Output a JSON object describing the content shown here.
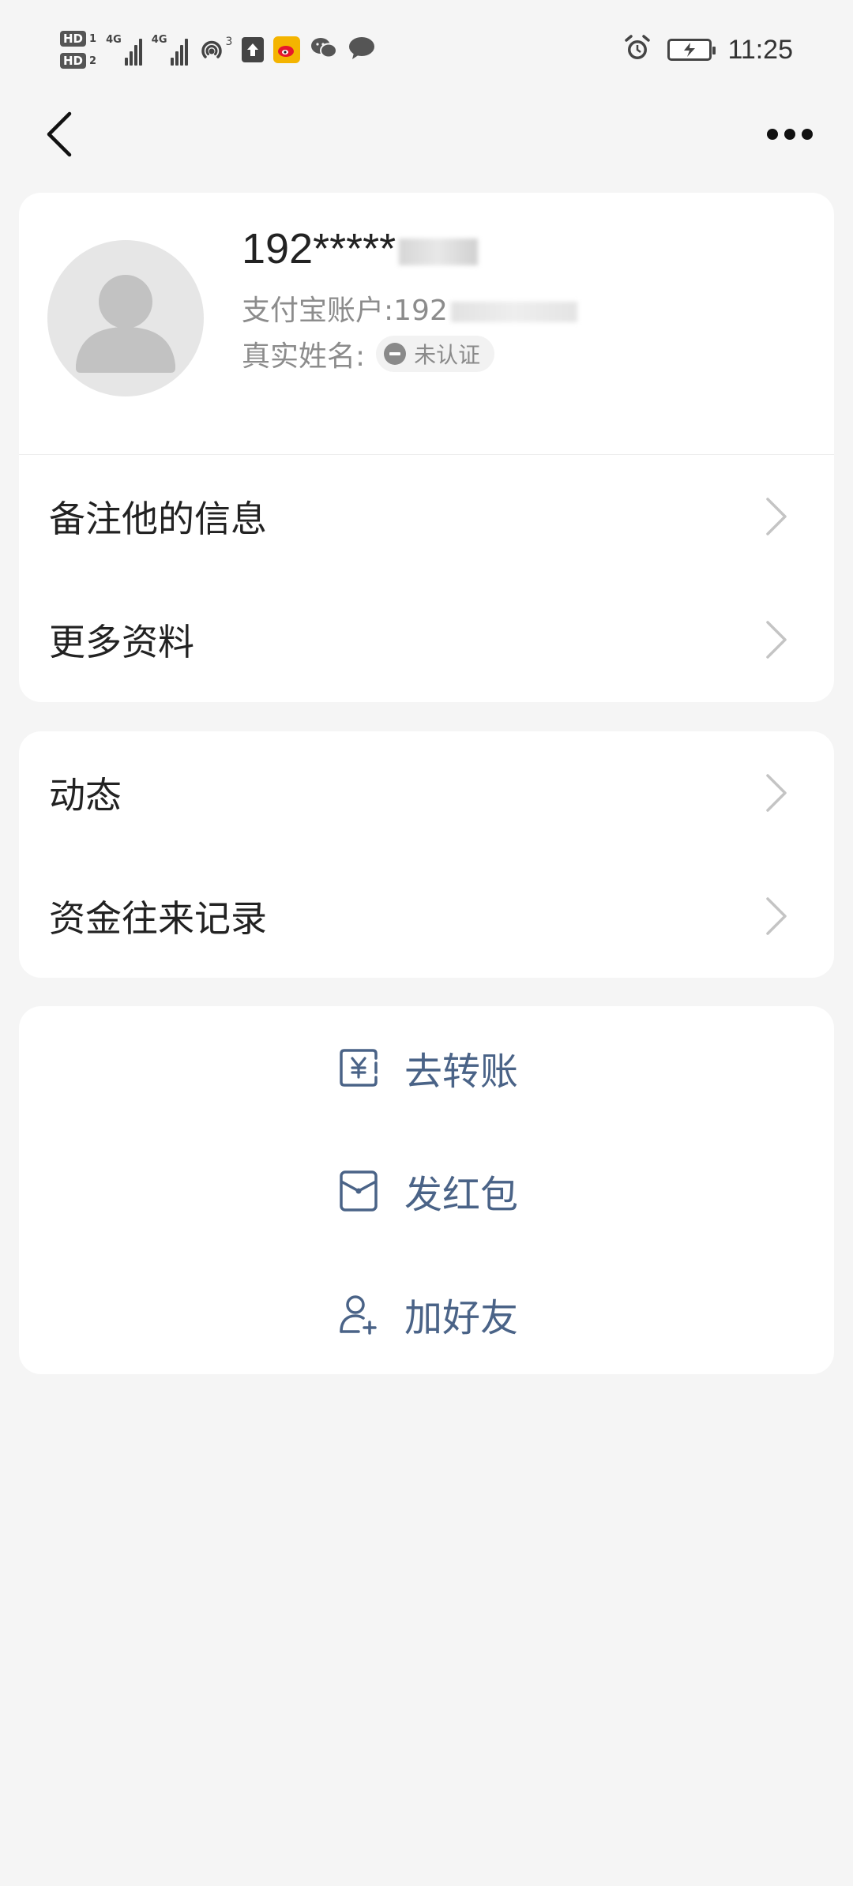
{
  "status_bar": {
    "sim1": "HD",
    "sim1_num": "1",
    "sim2": "HD",
    "sim2_num": "2",
    "net1": "4G",
    "net2": "4G",
    "hotspot_count": "3",
    "time": "11:25",
    "icons": [
      "hd-icon",
      "signal-icon",
      "hotspot-icon",
      "upload-icon",
      "weibo-icon",
      "wechat-icon",
      "message-icon",
      "alarm-icon",
      "battery-charging-icon"
    ]
  },
  "nav": {
    "back_icon": "chevron-left-icon",
    "more_icon": "more-dots-icon"
  },
  "profile": {
    "name": "192*****",
    "account_label": "支付宝账户:192",
    "realname_label": "真实姓名:",
    "verify_status": "未认证"
  },
  "info_rows": [
    {
      "label": "备注他的信息"
    },
    {
      "label": "更多资料"
    }
  ],
  "activity_rows": [
    {
      "label": "动态"
    },
    {
      "label": "资金往来记录"
    }
  ],
  "actions": [
    {
      "label": "去转账",
      "icon": "transfer-yuan-icon"
    },
    {
      "label": "发红包",
      "icon": "red-envelope-icon"
    },
    {
      "label": "加好友",
      "icon": "add-friend-icon"
    }
  ],
  "colors": {
    "background": "#f5f5f5",
    "card": "#ffffff",
    "action_text": "#4a6387",
    "secondary_text": "#8c8c8c"
  }
}
